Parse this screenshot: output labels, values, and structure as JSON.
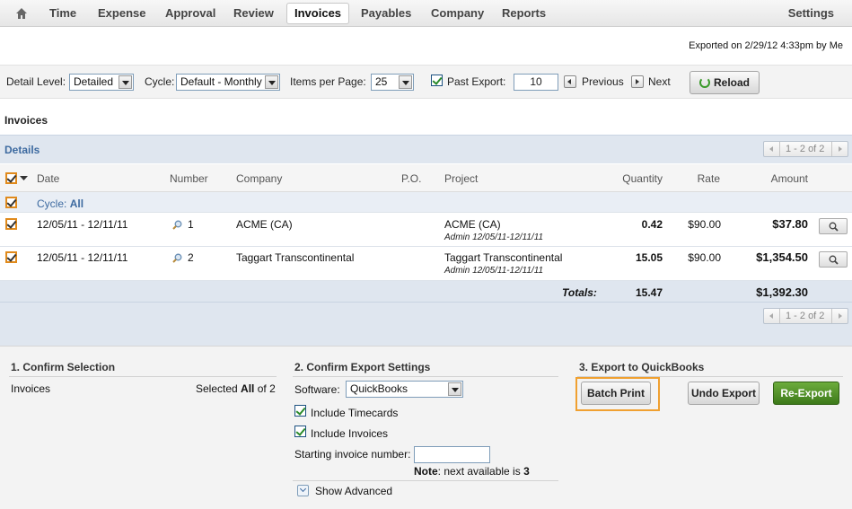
{
  "nav": {
    "items": [
      "Time",
      "Expense",
      "Approval",
      "Review",
      "Invoices",
      "Payables",
      "Company",
      "Reports"
    ],
    "active": "Invoices",
    "settings": "Settings"
  },
  "exported_text": "Exported on 2/29/12 4:33pm by Me",
  "controls": {
    "detail_level_label": "Detail Level:",
    "detail_level_value": "Detailed",
    "cycle_label": "Cycle:",
    "cycle_value": "Default - Monthly",
    "items_per_page_label": "Items per Page:",
    "items_per_page_value": "25",
    "past_export_label": "Past Export:",
    "past_export_value": "10",
    "previous": "Previous",
    "next": "Next",
    "reload": "Reload"
  },
  "section_title": "Invoices",
  "details": {
    "title": "Details",
    "pager": "1 - 2 of 2"
  },
  "table": {
    "headers": {
      "date": "Date",
      "number": "Number",
      "company": "Company",
      "po": "P.O.",
      "project": "Project",
      "quantity": "Quantity",
      "rate": "Rate",
      "amount": "Amount"
    },
    "cycle_label": "Cycle:",
    "cycle_value": "All",
    "rows": [
      {
        "date": "12/05/11 - 12/11/11",
        "number": "1",
        "company": "ACME (CA)",
        "project": "ACME (CA)",
        "project_sub": "Admin 12/05/11-12/11/11",
        "quantity": "0.42",
        "rate": "$90.00",
        "amount": "$37.80"
      },
      {
        "date": "12/05/11 - 12/11/11",
        "number": "2",
        "company": "Taggart Transcontinental",
        "project": "Taggart Transcontinental",
        "project_sub": "Admin 12/05/11-12/11/11",
        "quantity": "15.05",
        "rate": "$90.00",
        "amount": "$1,354.50"
      }
    ],
    "totals_label": "Totals:",
    "totals_quantity": "15.47",
    "totals_amount": "$1,392.30"
  },
  "steps": {
    "step1": {
      "title": "1. Confirm Selection",
      "left": "Invoices",
      "right_prefix": "Selected",
      "right_bold": "All",
      "right_suffix": "of 2"
    },
    "step2": {
      "title": "2. Confirm Export Settings",
      "software_label": "Software:",
      "software_value": "QuickBooks",
      "include_timecards": "Include Timecards",
      "include_invoices": "Include Invoices",
      "starting_label": "Starting invoice number:",
      "starting_value": "",
      "note_bold": "Note",
      "note_text": ": next available is",
      "note_value": "3",
      "show_advanced": "Show Advanced"
    },
    "step3": {
      "title": "3. Export to QuickBooks",
      "batch_print": "Batch Print",
      "undo_export": "Undo Export",
      "re_export": "Re-Export"
    }
  }
}
